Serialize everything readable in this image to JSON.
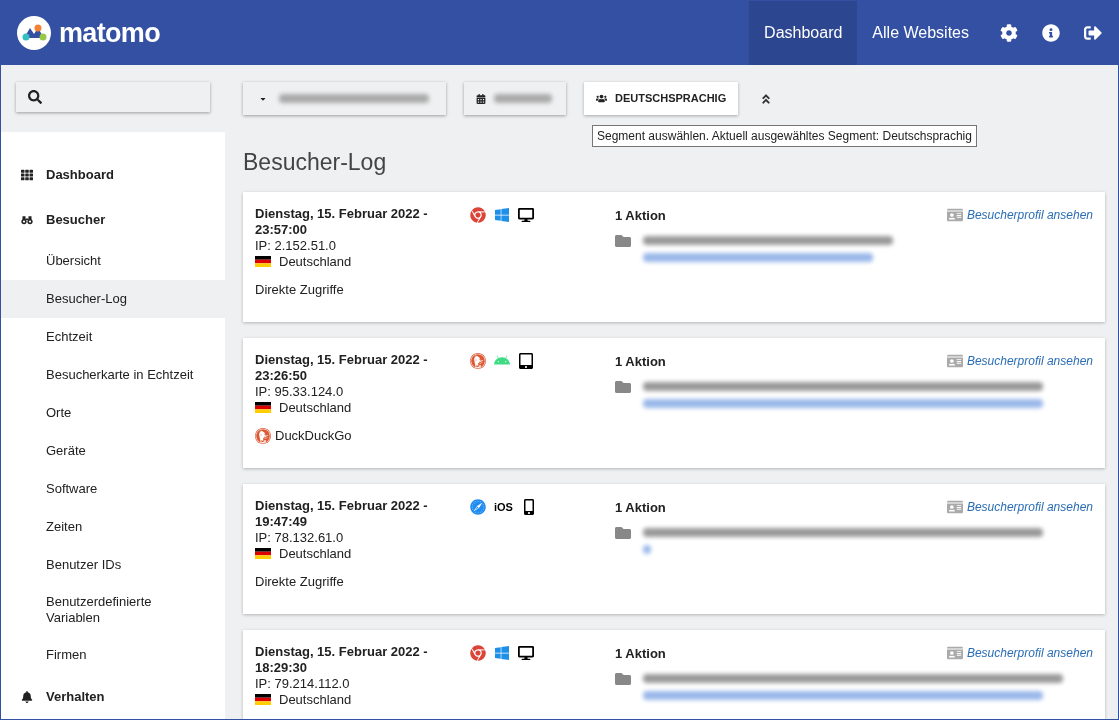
{
  "header": {
    "logo_text": "matomo",
    "nav": [
      {
        "label": "Dashboard",
        "selected": true
      },
      {
        "label": "Alle Websites",
        "selected": false
      }
    ]
  },
  "toolbar": {
    "segment": "DEUTSCHSPRACHIG",
    "tooltip": "Segment auswählen. Aktuell ausgewähltes Segment: Deutschsprachig"
  },
  "sidebar": {
    "items": [
      {
        "label": "Dashboard",
        "kind": "grid"
      },
      {
        "label": "Besucher",
        "kind": "binoculars",
        "children": [
          {
            "label": "Übersicht",
            "selected": false
          },
          {
            "label": "Besucher-Log",
            "selected": true
          },
          {
            "label": "Echtzeit",
            "selected": false
          },
          {
            "label": "Besucherkarte in Echtzeit",
            "selected": false
          },
          {
            "label": "Orte",
            "selected": false
          },
          {
            "label": "Geräte",
            "selected": false
          },
          {
            "label": "Software",
            "selected": false
          },
          {
            "label": "Zeiten",
            "selected": false
          },
          {
            "label": "Benutzer IDs",
            "selected": false
          },
          {
            "label": "Benutzerdefinierte Variablen",
            "selected": false
          },
          {
            "label": "Firmen",
            "selected": false
          }
        ]
      },
      {
        "label": "Verhalten",
        "kind": "bell"
      }
    ]
  },
  "page_title": "Besucher-Log",
  "visits": [
    {
      "date": "Dienstag, 15. Februar 2022 -",
      "time": "23:57:00",
      "ip": "IP: 2.152.51.0",
      "country": "Deutschland",
      "icons": [
        {
          "kind": "chrome"
        },
        {
          "kind": "windows"
        },
        {
          "kind": "desktop"
        }
      ],
      "referrer": {
        "kind": "direct",
        "label": "Direkte Zugriffe"
      },
      "actions": "1 Aktion",
      "profile_link": "Besucherprofil ansehen"
    },
    {
      "date": "Dienstag, 15. Februar 2022 -",
      "time": "23:26:50",
      "ip": "IP: 95.33.124.0",
      "country": "Deutschland",
      "icons": [
        {
          "kind": "duckduckgo"
        },
        {
          "kind": "android"
        },
        {
          "kind": "tablet"
        }
      ],
      "referrer": {
        "kind": "search",
        "label": "DuckDuckGo"
      },
      "actions": "1 Aktion",
      "profile_link": "Besucherprofil ansehen"
    },
    {
      "date": "Dienstag, 15. Februar 2022 -",
      "time": "19:47:49",
      "ip": "IP: 78.132.61.0",
      "country": "Deutschland",
      "icons": [
        {
          "kind": "safari"
        },
        {
          "kind": "text",
          "text": "iOS"
        },
        {
          "kind": "phone"
        }
      ],
      "referrer": {
        "kind": "direct",
        "label": "Direkte Zugriffe"
      },
      "actions": "1 Aktion",
      "profile_link": "Besucherprofil ansehen"
    },
    {
      "date": "Dienstag, 15. Februar 2022 -",
      "time": "18:29:30",
      "ip": "IP: 79.214.112.0",
      "country": "Deutschland",
      "icons": [
        {
          "kind": "chrome"
        },
        {
          "kind": "windows"
        },
        {
          "kind": "desktop"
        }
      ],
      "actions": "1 Aktion",
      "profile_link": "Besucherprofil ansehen"
    }
  ]
}
